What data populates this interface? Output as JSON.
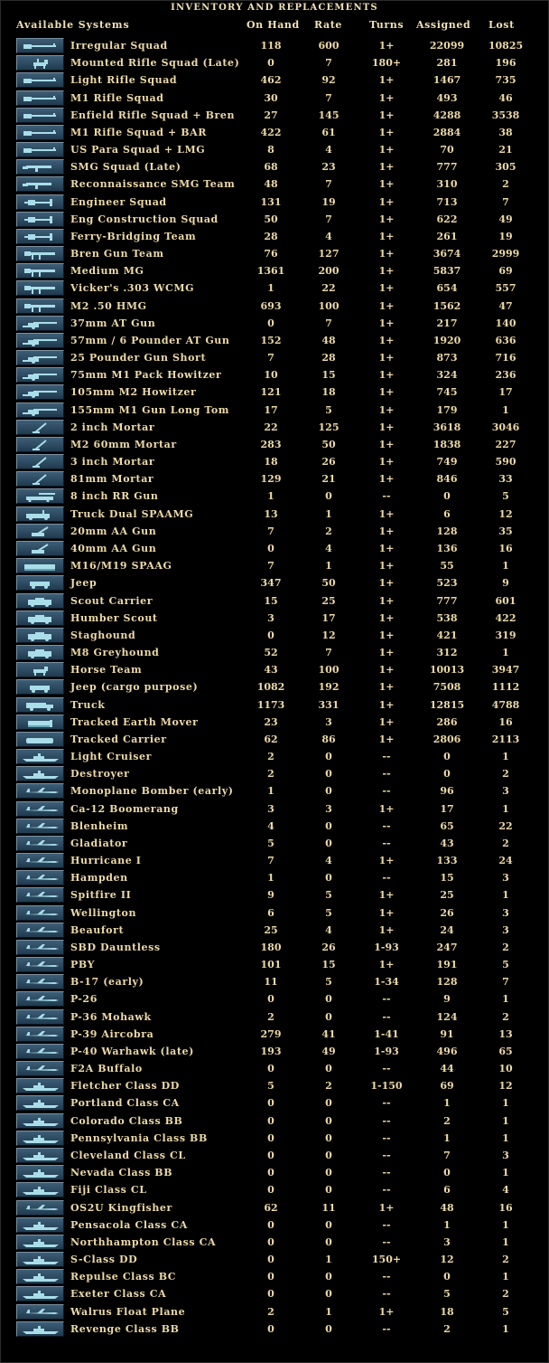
{
  "window": {
    "title": "INVENTORY AND REPLACEMENTS"
  },
  "columns": {
    "name": "Available Systems",
    "on_hand": "On Hand",
    "rate": "Rate",
    "turns": "Turns",
    "assigned": "Assigned",
    "lost": "Lost"
  },
  "colors": {
    "background": "#000000",
    "text": "#ecd9a8",
    "icon_bg": "#2e4a60",
    "icon_glyph": "#a9dde8"
  },
  "rows": [
    {
      "name": "Irregular Squad",
      "on_hand": "118",
      "rate": "600",
      "turns": "1+",
      "assigned": "22099",
      "lost": "10825",
      "icon": "rifle-icon"
    },
    {
      "name": "Mounted Rifle Squad (Late)",
      "on_hand": "0",
      "rate": "7",
      "turns": "180+",
      "assigned": "281",
      "lost": "196",
      "icon": "horse-rifle-icon"
    },
    {
      "name": "Light Rifle Squad",
      "on_hand": "462",
      "rate": "92",
      "turns": "1+",
      "assigned": "1467",
      "lost": "735",
      "icon": "rifle-icon"
    },
    {
      "name": "M1 Rifle Squad",
      "on_hand": "30",
      "rate": "7",
      "turns": "1+",
      "assigned": "493",
      "lost": "46",
      "icon": "rifle-icon"
    },
    {
      "name": "Enfield Rifle Squad + Bren",
      "on_hand": "27",
      "rate": "145",
      "turns": "1+",
      "assigned": "4288",
      "lost": "3538",
      "icon": "rifle-icon"
    },
    {
      "name": "M1 Rifle Squad + BAR",
      "on_hand": "422",
      "rate": "61",
      "turns": "1+",
      "assigned": "2884",
      "lost": "38",
      "icon": "rifle-icon"
    },
    {
      "name": "US Para Squad + LMG",
      "on_hand": "8",
      "rate": "4",
      "turns": "1+",
      "assigned": "70",
      "lost": "21",
      "icon": "rifle-icon"
    },
    {
      "name": "SMG Squad (Late)",
      "on_hand": "68",
      "rate": "23",
      "turns": "1+",
      "assigned": "777",
      "lost": "305",
      "icon": "smg-icon"
    },
    {
      "name": "Reconnaissance SMG Team",
      "on_hand": "48",
      "rate": "7",
      "turns": "1+",
      "assigned": "310",
      "lost": "2",
      "icon": "smg-icon"
    },
    {
      "name": "Engineer Squad",
      "on_hand": "131",
      "rate": "19",
      "turns": "1+",
      "assigned": "713",
      "lost": "7",
      "icon": "engineer-icon"
    },
    {
      "name": "Eng Construction Squad",
      "on_hand": "50",
      "rate": "7",
      "turns": "1+",
      "assigned": "622",
      "lost": "49",
      "icon": "engineer-icon"
    },
    {
      "name": "Ferry-Bridging Team",
      "on_hand": "28",
      "rate": "4",
      "turns": "1+",
      "assigned": "261",
      "lost": "19",
      "icon": "engineer-icon"
    },
    {
      "name": "Bren Gun Team",
      "on_hand": "76",
      "rate": "127",
      "turns": "1+",
      "assigned": "3674",
      "lost": "2999",
      "icon": "machinegun-icon"
    },
    {
      "name": "Medium MG",
      "on_hand": "1361",
      "rate": "200",
      "turns": "1+",
      "assigned": "5837",
      "lost": "69",
      "icon": "machinegun-icon"
    },
    {
      "name": "Vicker's .303 WCMG",
      "on_hand": "1",
      "rate": "22",
      "turns": "1+",
      "assigned": "654",
      "lost": "557",
      "icon": "machinegun-icon"
    },
    {
      "name": "M2 .50 HMG",
      "on_hand": "693",
      "rate": "100",
      "turns": "1+",
      "assigned": "1562",
      "lost": "47",
      "icon": "machinegun-icon"
    },
    {
      "name": "37mm AT Gun",
      "on_hand": "0",
      "rate": "7",
      "turns": "1+",
      "assigned": "217",
      "lost": "140",
      "icon": "field-gun-icon"
    },
    {
      "name": "57mm / 6 Pounder AT Gun",
      "on_hand": "152",
      "rate": "48",
      "turns": "1+",
      "assigned": "1920",
      "lost": "636",
      "icon": "field-gun-icon"
    },
    {
      "name": "25 Pounder Gun Short",
      "on_hand": "7",
      "rate": "28",
      "turns": "1+",
      "assigned": "873",
      "lost": "716",
      "icon": "field-gun-icon"
    },
    {
      "name": "75mm M1 Pack Howitzer",
      "on_hand": "10",
      "rate": "15",
      "turns": "1+",
      "assigned": "324",
      "lost": "236",
      "icon": "field-gun-icon"
    },
    {
      "name": "105mm M2 Howitzer",
      "on_hand": "121",
      "rate": "18",
      "turns": "1+",
      "assigned": "745",
      "lost": "17",
      "icon": "field-gun-icon"
    },
    {
      "name": "155mm M1 Gun Long Tom",
      "on_hand": "17",
      "rate": "5",
      "turns": "1+",
      "assigned": "179",
      "lost": "1",
      "icon": "field-gun-icon"
    },
    {
      "name": "2 inch Mortar",
      "on_hand": "22",
      "rate": "125",
      "turns": "1+",
      "assigned": "3618",
      "lost": "3046",
      "icon": "mortar-icon"
    },
    {
      "name": "M2 60mm Mortar",
      "on_hand": "283",
      "rate": "50",
      "turns": "1+",
      "assigned": "1838",
      "lost": "227",
      "icon": "mortar-icon"
    },
    {
      "name": "3 inch Mortar",
      "on_hand": "18",
      "rate": "26",
      "turns": "1+",
      "assigned": "749",
      "lost": "590",
      "icon": "mortar-icon"
    },
    {
      "name": "81mm Mortar",
      "on_hand": "129",
      "rate": "21",
      "turns": "1+",
      "assigned": "846",
      "lost": "33",
      "icon": "mortar-icon"
    },
    {
      "name": "8 inch RR Gun",
      "on_hand": "1",
      "rate": "0",
      "turns": "--",
      "assigned": "0",
      "lost": "5",
      "icon": "railway-gun-icon"
    },
    {
      "name": "Truck Dual SPAAMG",
      "on_hand": "13",
      "rate": "1",
      "turns": "1+",
      "assigned": "6",
      "lost": "12",
      "icon": "aa-vehicle-icon"
    },
    {
      "name": "20mm AA Gun",
      "on_hand": "7",
      "rate": "2",
      "turns": "1+",
      "assigned": "128",
      "lost": "35",
      "icon": "aa-gun-icon"
    },
    {
      "name": "40mm AA Gun",
      "on_hand": "0",
      "rate": "4",
      "turns": "1+",
      "assigned": "136",
      "lost": "16",
      "icon": "aa-gun-icon"
    },
    {
      "name": "M16/M19 SPAAG",
      "on_hand": "7",
      "rate": "1",
      "turns": "1+",
      "assigned": "55",
      "lost": "1",
      "icon": "halftrack-icon"
    },
    {
      "name": "Jeep",
      "on_hand": "347",
      "rate": "50",
      "turns": "1+",
      "assigned": "523",
      "lost": "9",
      "icon": "jeep-icon"
    },
    {
      "name": "Scout Carrier",
      "on_hand": "15",
      "rate": "25",
      "turns": "1+",
      "assigned": "777",
      "lost": "601",
      "icon": "armored-car-icon"
    },
    {
      "name": "Humber Scout",
      "on_hand": "3",
      "rate": "17",
      "turns": "1+",
      "assigned": "538",
      "lost": "422",
      "icon": "armored-car-icon"
    },
    {
      "name": "Staghound",
      "on_hand": "0",
      "rate": "12",
      "turns": "1+",
      "assigned": "421",
      "lost": "319",
      "icon": "armored-car-icon"
    },
    {
      "name": "M8 Greyhound",
      "on_hand": "52",
      "rate": "7",
      "turns": "1+",
      "assigned": "312",
      "lost": "1",
      "icon": "armored-car-icon"
    },
    {
      "name": "Horse Team",
      "on_hand": "43",
      "rate": "100",
      "turns": "1+",
      "assigned": "10013",
      "lost": "3947",
      "icon": "horse-icon"
    },
    {
      "name": "Jeep (cargo purpose)",
      "on_hand": "1082",
      "rate": "192",
      "turns": "1+",
      "assigned": "7508",
      "lost": "1112",
      "icon": "jeep-icon"
    },
    {
      "name": "Truck",
      "on_hand": "1173",
      "rate": "331",
      "turns": "1+",
      "assigned": "12815",
      "lost": "4788",
      "icon": "truck-icon"
    },
    {
      "name": "Tracked Earth Mover",
      "on_hand": "23",
      "rate": "3",
      "turns": "1+",
      "assigned": "286",
      "lost": "16",
      "icon": "bulldozer-icon"
    },
    {
      "name": "Tracked Carrier",
      "on_hand": "62",
      "rate": "86",
      "turns": "1+",
      "assigned": "2806",
      "lost": "2113",
      "icon": "tracked-carrier-icon"
    },
    {
      "name": "Light Cruiser",
      "on_hand": "2",
      "rate": "0",
      "turns": "--",
      "assigned": "0",
      "lost": "1",
      "icon": "ship-icon"
    },
    {
      "name": "Destroyer",
      "on_hand": "2",
      "rate": "0",
      "turns": "--",
      "assigned": "0",
      "lost": "2",
      "icon": "ship-icon"
    },
    {
      "name": "Monoplane Bomber (early)",
      "on_hand": "1",
      "rate": "0",
      "turns": "--",
      "assigned": "96",
      "lost": "3",
      "icon": "aircraft-icon"
    },
    {
      "name": "Ca-12 Boomerang",
      "on_hand": "3",
      "rate": "3",
      "turns": "1+",
      "assigned": "17",
      "lost": "1",
      "icon": "aircraft-icon"
    },
    {
      "name": "Blenheim",
      "on_hand": "4",
      "rate": "0",
      "turns": "--",
      "assigned": "65",
      "lost": "22",
      "icon": "aircraft-icon"
    },
    {
      "name": "Gladiator",
      "on_hand": "5",
      "rate": "0",
      "turns": "--",
      "assigned": "43",
      "lost": "2",
      "icon": "aircraft-icon"
    },
    {
      "name": "Hurricane I",
      "on_hand": "7",
      "rate": "4",
      "turns": "1+",
      "assigned": "133",
      "lost": "24",
      "icon": "aircraft-icon"
    },
    {
      "name": "Hampden",
      "on_hand": "1",
      "rate": "0",
      "turns": "--",
      "assigned": "15",
      "lost": "3",
      "icon": "aircraft-icon"
    },
    {
      "name": "Spitfire II",
      "on_hand": "9",
      "rate": "5",
      "turns": "1+",
      "assigned": "25",
      "lost": "1",
      "icon": "aircraft-icon"
    },
    {
      "name": "Wellington",
      "on_hand": "6",
      "rate": "5",
      "turns": "1+",
      "assigned": "26",
      "lost": "3",
      "icon": "aircraft-icon"
    },
    {
      "name": "Beaufort",
      "on_hand": "25",
      "rate": "4",
      "turns": "1+",
      "assigned": "24",
      "lost": "3",
      "icon": "aircraft-icon"
    },
    {
      "name": "SBD Dauntless",
      "on_hand": "180",
      "rate": "26",
      "turns": "1-93",
      "assigned": "247",
      "lost": "2",
      "icon": "aircraft-icon"
    },
    {
      "name": "PBY",
      "on_hand": "101",
      "rate": "15",
      "turns": "1+",
      "assigned": "191",
      "lost": "5",
      "icon": "aircraft-icon"
    },
    {
      "name": "B-17 (early)",
      "on_hand": "11",
      "rate": "5",
      "turns": "1-34",
      "assigned": "128",
      "lost": "7",
      "icon": "aircraft-icon"
    },
    {
      "name": "P-26",
      "on_hand": "0",
      "rate": "0",
      "turns": "--",
      "assigned": "9",
      "lost": "1",
      "icon": "aircraft-icon"
    },
    {
      "name": "P-36 Mohawk",
      "on_hand": "2",
      "rate": "0",
      "turns": "--",
      "assigned": "124",
      "lost": "2",
      "icon": "aircraft-icon"
    },
    {
      "name": "P-39 Aircobra",
      "on_hand": "279",
      "rate": "41",
      "turns": "1-41",
      "assigned": "91",
      "lost": "13",
      "icon": "aircraft-icon"
    },
    {
      "name": "P-40 Warhawk (late)",
      "on_hand": "193",
      "rate": "49",
      "turns": "1-93",
      "assigned": "496",
      "lost": "65",
      "icon": "aircraft-icon"
    },
    {
      "name": "F2A Buffalo",
      "on_hand": "0",
      "rate": "0",
      "turns": "--",
      "assigned": "44",
      "lost": "10",
      "icon": "aircraft-icon"
    },
    {
      "name": "Fletcher Class DD",
      "on_hand": "5",
      "rate": "2",
      "turns": "1-150",
      "assigned": "69",
      "lost": "12",
      "icon": "ship-icon"
    },
    {
      "name": "Portland Class CA",
      "on_hand": "0",
      "rate": "0",
      "turns": "--",
      "assigned": "1",
      "lost": "1",
      "icon": "ship-icon"
    },
    {
      "name": "Colorado Class BB",
      "on_hand": "0",
      "rate": "0",
      "turns": "--",
      "assigned": "2",
      "lost": "1",
      "icon": "ship-icon"
    },
    {
      "name": "Pennsylvania Class BB",
      "on_hand": "0",
      "rate": "0",
      "turns": "--",
      "assigned": "1",
      "lost": "1",
      "icon": "ship-icon"
    },
    {
      "name": "Cleveland Class CL",
      "on_hand": "0",
      "rate": "0",
      "turns": "--",
      "assigned": "7",
      "lost": "3",
      "icon": "ship-icon"
    },
    {
      "name": "Nevada Class BB",
      "on_hand": "0",
      "rate": "0",
      "turns": "--",
      "assigned": "0",
      "lost": "1",
      "icon": "ship-icon"
    },
    {
      "name": "Fiji Class CL",
      "on_hand": "0",
      "rate": "0",
      "turns": "--",
      "assigned": "6",
      "lost": "4",
      "icon": "ship-icon"
    },
    {
      "name": "OS2U Kingfisher",
      "on_hand": "62",
      "rate": "11",
      "turns": "1+",
      "assigned": "48",
      "lost": "16",
      "icon": "aircraft-icon"
    },
    {
      "name": "Pensacola Class CA",
      "on_hand": "0",
      "rate": "0",
      "turns": "--",
      "assigned": "1",
      "lost": "1",
      "icon": "ship-icon"
    },
    {
      "name": "Northhampton Class CA",
      "on_hand": "0",
      "rate": "0",
      "turns": "--",
      "assigned": "3",
      "lost": "1",
      "icon": "ship-icon"
    },
    {
      "name": "S-Class DD",
      "on_hand": "0",
      "rate": "1",
      "turns": "150+",
      "assigned": "12",
      "lost": "2",
      "icon": "ship-icon"
    },
    {
      "name": "Repulse Class BC",
      "on_hand": "0",
      "rate": "0",
      "turns": "--",
      "assigned": "0",
      "lost": "1",
      "icon": "ship-icon"
    },
    {
      "name": "Exeter Class CA",
      "on_hand": "0",
      "rate": "0",
      "turns": "--",
      "assigned": "5",
      "lost": "2",
      "icon": "ship-icon"
    },
    {
      "name": "Walrus Float Plane",
      "on_hand": "2",
      "rate": "1",
      "turns": "1+",
      "assigned": "18",
      "lost": "5",
      "icon": "aircraft-icon"
    },
    {
      "name": "Revenge Class BB",
      "on_hand": "0",
      "rate": "0",
      "turns": "--",
      "assigned": "2",
      "lost": "1",
      "icon": "ship-icon"
    }
  ]
}
